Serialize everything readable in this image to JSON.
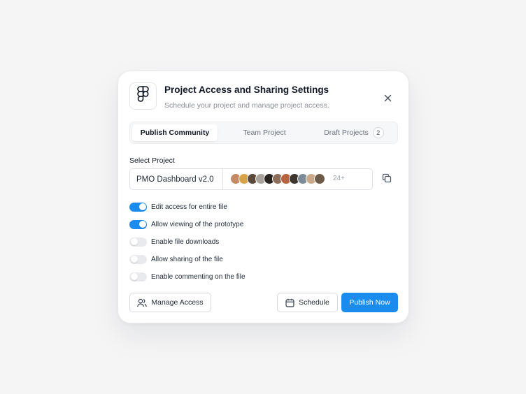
{
  "dialog": {
    "title": "Project Access and Sharing Settings",
    "subtitle": "Schedule your project and manage project access.",
    "logo_icon": "figma-logo-icon",
    "close_icon": "close-icon"
  },
  "tabs": [
    {
      "label": "Publish Community",
      "active": true
    },
    {
      "label": "Team Project",
      "active": false
    },
    {
      "label": "Draft Projects",
      "active": false,
      "count": "2"
    }
  ],
  "select_project": {
    "label": "Select Project",
    "value": "PMO Dashboard v2.0",
    "more_count": "24+",
    "copy_icon": "copy-icon"
  },
  "toggles": [
    {
      "label": "Edit access for entire file",
      "on": true
    },
    {
      "label": "Allow viewing of the prototype",
      "on": true
    },
    {
      "label": "Enable file downloads",
      "on": false
    },
    {
      "label": "Allow sharing of the file",
      "on": false
    },
    {
      "label": "Enable commenting on the file",
      "on": false
    }
  ],
  "actions": {
    "manage_access": "Manage Access",
    "schedule": "Schedule",
    "publish_now": "Publish Now"
  },
  "colors": {
    "accent": "#1a8cf0",
    "toggle_off": "#e8eaed"
  }
}
